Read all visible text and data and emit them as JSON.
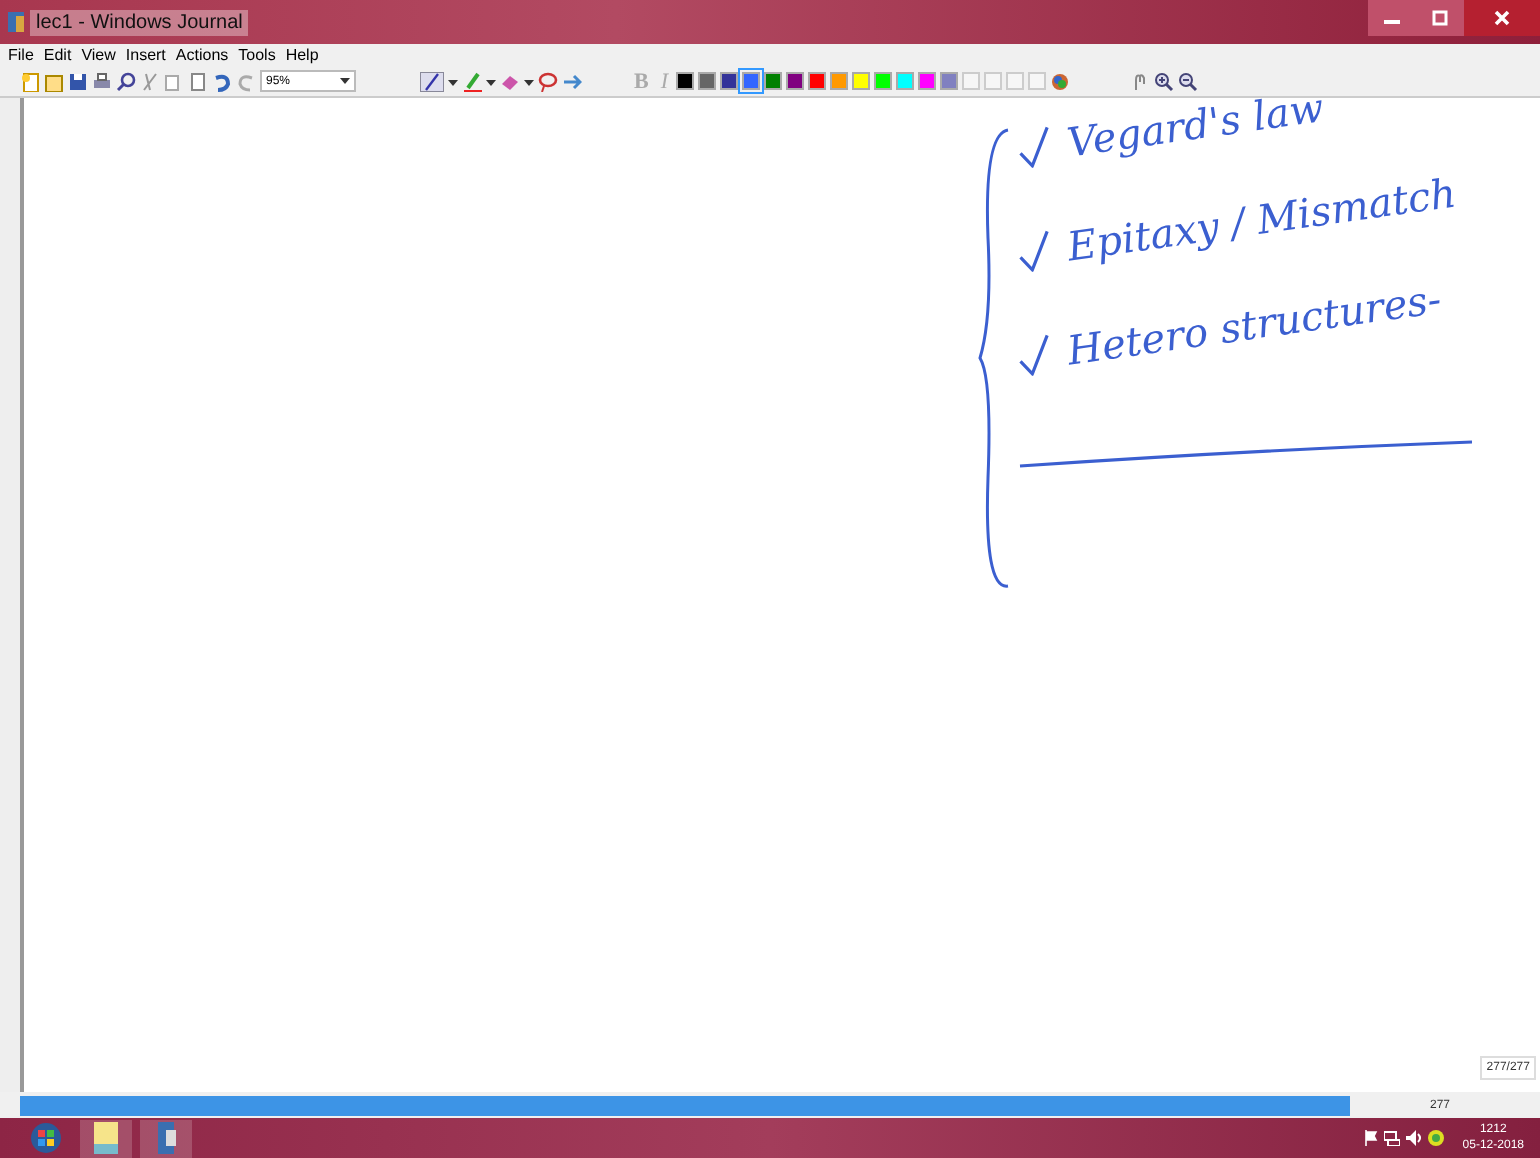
{
  "window": {
    "title": "lec1 - Windows Journal"
  },
  "menu": [
    "File",
    "Edit",
    "View",
    "Insert",
    "Actions",
    "Tools",
    "Help"
  ],
  "toolbar": {
    "zoom": "95%",
    "bold": "B",
    "italic": "I",
    "palette": [
      {
        "color": "#000000",
        "selected": false
      },
      {
        "color": "#666666",
        "selected": false
      },
      {
        "color": "#333399",
        "selected": false
      },
      {
        "color": "#3366ff",
        "selected": true
      },
      {
        "color": "#008000",
        "selected": false
      },
      {
        "color": "#800080",
        "selected": false
      },
      {
        "color": "#ff0000",
        "selected": false
      },
      {
        "color": "#ff9900",
        "selected": false
      },
      {
        "color": "#ffff00",
        "selected": false
      },
      {
        "color": "#00ff00",
        "selected": false
      },
      {
        "color": "#00ffff",
        "selected": false
      },
      {
        "color": "#ff00ff",
        "selected": false
      },
      {
        "color": "#8080c0",
        "selected": false
      }
    ]
  },
  "notes": [
    {
      "text": "Vegard's law",
      "checked": true
    },
    {
      "text": "Epitaxy / Mismatch",
      "checked": true
    },
    {
      "text": "Hetero structures-",
      "checked": true
    }
  ],
  "page_counter": "277/277",
  "status_bar": {
    "page": "277"
  },
  "taskbar": {
    "time": "1212",
    "date": "05-12-2018"
  }
}
